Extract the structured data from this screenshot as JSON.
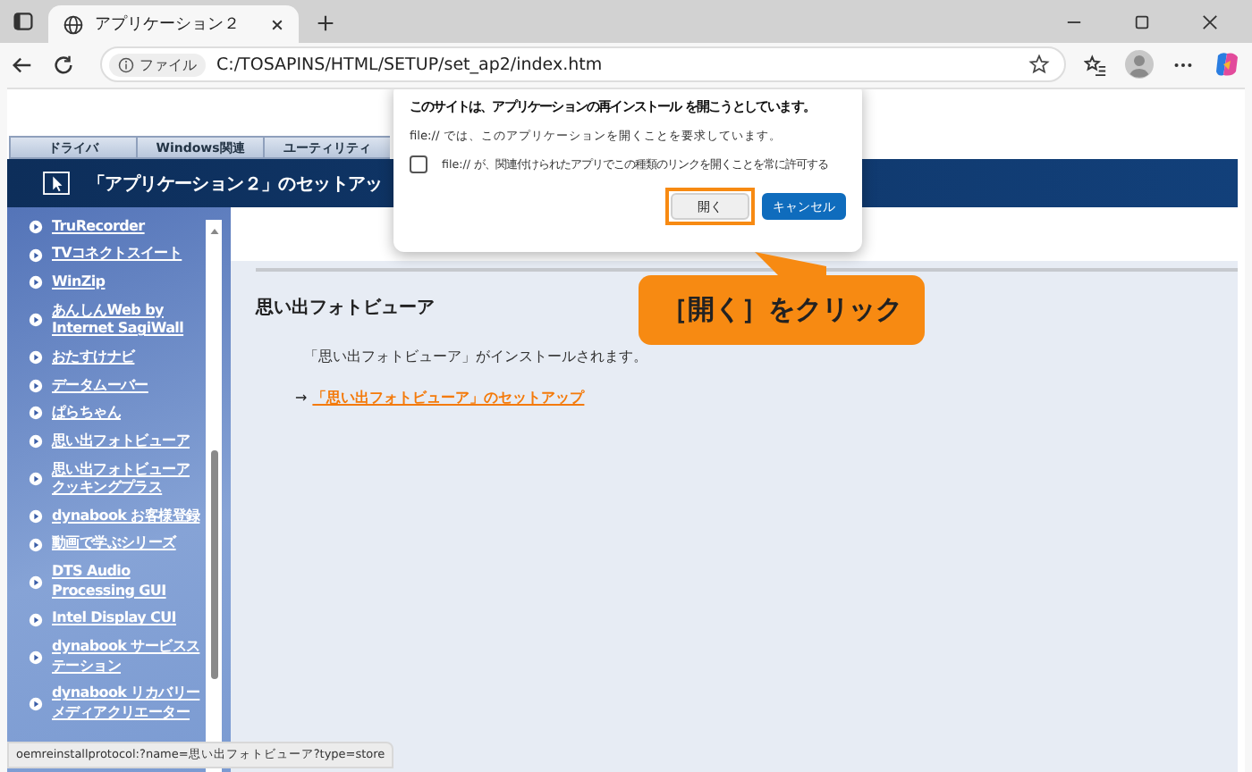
{
  "browser": {
    "tab_title": "アプリケーション２",
    "address_label": "ファイル",
    "url": "C:/TOSAPINS/HTML/SETUP/set_ap2/index.htm"
  },
  "page": {
    "nav_tabs": [
      "ドライバ",
      "Windows関連",
      "ユーティリティ"
    ],
    "title": "「アプリケーション２」のセットアッ",
    "sidebar_links": [
      {
        "lines": [
          "TruRecorder"
        ]
      },
      {
        "lines": [
          "TVコネクトスイート"
        ]
      },
      {
        "lines": [
          "WinZip"
        ]
      },
      {
        "lines": [
          "あんしんWeb by",
          "Internet SagiWall"
        ]
      },
      {
        "lines": [
          "おたすけナビ"
        ]
      },
      {
        "lines": [
          "データムーバー"
        ]
      },
      {
        "lines": [
          "ぱらちゃん"
        ]
      },
      {
        "lines": [
          "思い出フォトビューア"
        ]
      },
      {
        "lines": [
          "思い出フォトビューア",
          "クッキングプラス"
        ]
      },
      {
        "lines": [
          "dynabook お客様登録"
        ]
      },
      {
        "lines": [
          "動画で学ぶシリーズ"
        ]
      },
      {
        "lines": [
          "DTS Audio",
          "Processing GUI"
        ]
      },
      {
        "lines": [
          "Intel Display CUI"
        ]
      },
      {
        "lines": [
          "dynabook サービスス",
          "テーション"
        ]
      },
      {
        "lines": [
          "dynabook リカバリー",
          "メディアクリエーター"
        ]
      }
    ],
    "heading": "思い出フォトビューア",
    "description": "「思い出フォトビューア」がインストールされます。",
    "arrow": "→",
    "setup_link": "「思い出フォトビューア」のセットアップ"
  },
  "dialog": {
    "title": "このサイトは、アプリケーションの再インストール を開こうとしています。",
    "message": "file:// では、このアプリケーションを開くことを要求しています。",
    "checkbox": {
      "label": "file:// が、関連付けられたアプリでこの種類のリンクを開くことを常に許可する",
      "checked": false
    },
    "buttons": [
      {
        "label": "開く",
        "kind": "secondary",
        "highlighted": true
      },
      {
        "label": "キャンセル",
        "kind": "primary",
        "highlighted": false
      }
    ]
  },
  "callout": "［開く］をクリック",
  "status_bar": "oemreinstallprotocol:?name=思い出フォトビューア?type=store"
}
